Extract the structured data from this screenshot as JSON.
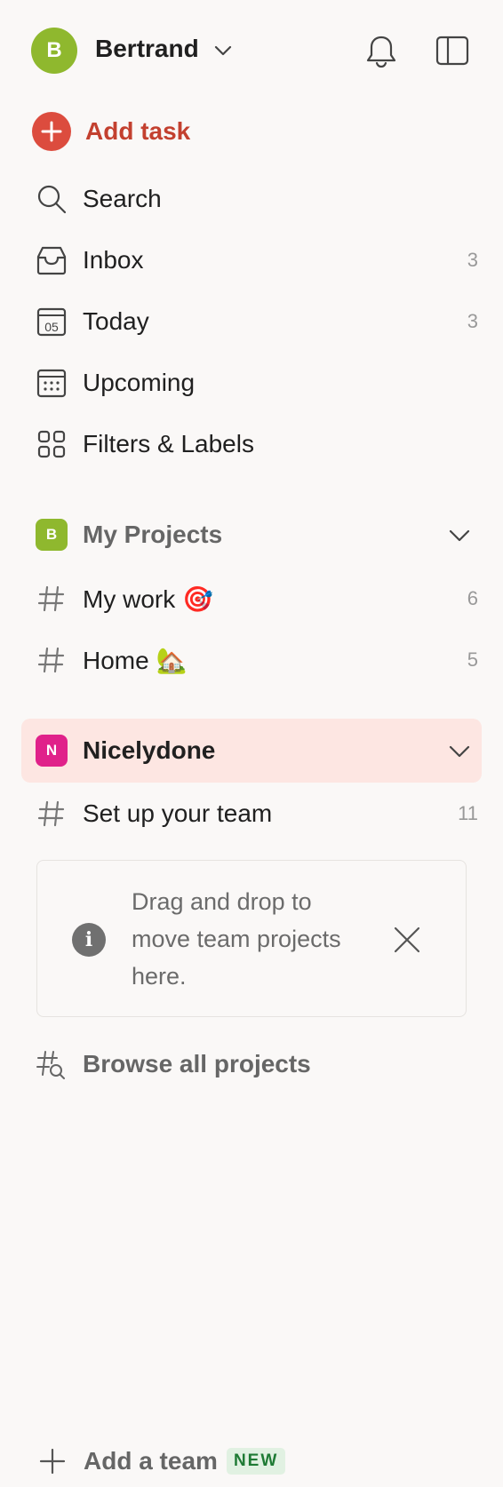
{
  "header": {
    "avatar_initial": "B",
    "user_name": "Bertrand",
    "avatar_color": "#8fb82e"
  },
  "add_task": {
    "label": "Add task",
    "accent": "#dc4c3e"
  },
  "nav": [
    {
      "key": "search",
      "label": "Search",
      "count": "",
      "icon": "search-icon"
    },
    {
      "key": "inbox",
      "label": "Inbox",
      "count": "3",
      "icon": "inbox-icon"
    },
    {
      "key": "today",
      "label": "Today",
      "count": "3",
      "icon": "calendar-today-icon",
      "date_number": "05"
    },
    {
      "key": "upcoming",
      "label": "Upcoming",
      "count": "",
      "icon": "calendar-grid-icon"
    },
    {
      "key": "filters",
      "label": "Filters & Labels",
      "count": "",
      "icon": "grid-icon"
    }
  ],
  "my_projects": {
    "badge": "B",
    "badge_color": "#8fb82e",
    "label": "My Projects",
    "projects": [
      {
        "label": "My work 🎯",
        "count": "6"
      },
      {
        "label": "Home 🏡",
        "count": "5"
      }
    ]
  },
  "team": {
    "badge": "N",
    "badge_color": "#e0218a",
    "label": "Nicelydone",
    "highlight": "#fde6e2",
    "projects": [
      {
        "label": "Set up your team",
        "count": "11"
      }
    ]
  },
  "hint": {
    "text": "Drag and drop to move team projects here."
  },
  "browse": {
    "label": "Browse all projects"
  },
  "add_team": {
    "label": "Add a team",
    "badge": "NEW"
  }
}
